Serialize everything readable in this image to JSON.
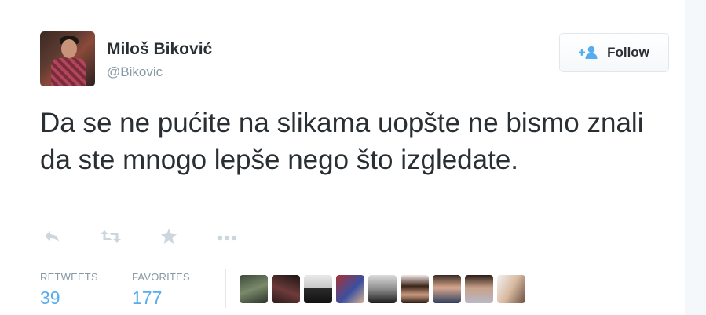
{
  "author": {
    "name": "Miloš Biković",
    "handle": "@Bikovic",
    "avatar_icon": "profile-photo"
  },
  "follow_button": {
    "label": "Follow",
    "icon": "add-user-icon"
  },
  "tweet": {
    "text": "Da se ne pućite na slikama uopšte ne bismo znali da ste mnogo lepše nego što izgledate."
  },
  "actions": [
    {
      "name": "reply",
      "icon": "reply-icon"
    },
    {
      "name": "retweet",
      "icon": "retweet-icon"
    },
    {
      "name": "favorite",
      "icon": "star-icon"
    },
    {
      "name": "more",
      "icon": "more-icon"
    }
  ],
  "stats": {
    "retweets": {
      "label": "RETWEETS",
      "value": "39"
    },
    "favorites": {
      "label": "FAVORITES",
      "value": "177"
    }
  },
  "favoriter_avatars_count": 9,
  "colors": {
    "accent": "#55acee",
    "muted": "#8899a6",
    "text": "#292f33",
    "border": "#e1e8ed"
  }
}
